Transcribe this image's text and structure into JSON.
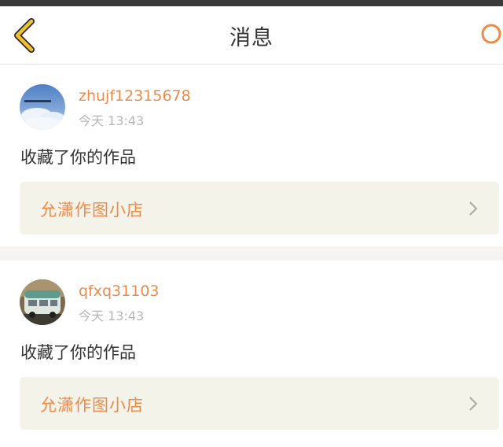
{
  "header": {
    "title": "消息",
    "back_icon": "chevron-left-icon",
    "search_icon": "search-icon",
    "accent_color": "#f2c12e"
  },
  "messages": [
    {
      "username": "zhujf12315678",
      "time": "今天 13:43",
      "action": "收藏了你的作品",
      "work_title": "允潇作图小店",
      "avatar": "sky-clouds-avatar"
    },
    {
      "username": "qfxq31103",
      "time": "今天 13:43",
      "action": "收藏了你的作品",
      "work_title": "允潇作图小店",
      "avatar": "vintage-van-avatar"
    }
  ],
  "colors": {
    "username": "#ee8a48",
    "time": "#b5b5b5",
    "link_bg": "#f4f3ea",
    "separator": "#f6f3f3"
  }
}
